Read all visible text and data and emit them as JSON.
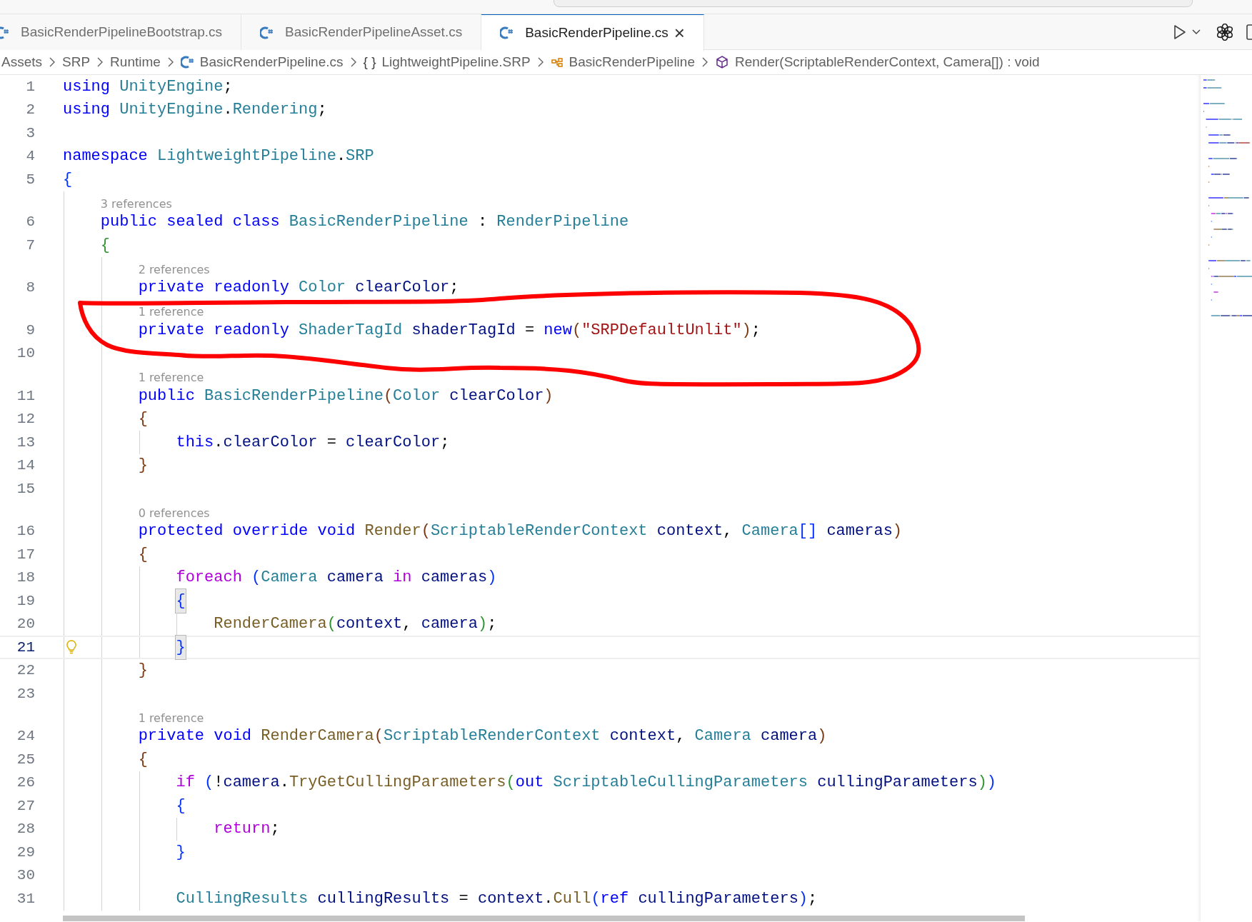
{
  "tabs": [
    {
      "label": "BasicRenderPipelineBootstrap.cs",
      "selected": false
    },
    {
      "label": "BasicRenderPipelineAsset.cs",
      "selected": false
    },
    {
      "label": "BasicRenderPipeline.cs",
      "selected": true,
      "close": "×"
    }
  ],
  "breadcrumb": [
    {
      "kind": "folder",
      "label": "Assets"
    },
    {
      "kind": "folder",
      "label": "SRP"
    },
    {
      "kind": "folder",
      "label": "Runtime"
    },
    {
      "kind": "file",
      "label": "BasicRenderPipeline.cs"
    },
    {
      "kind": "namespace",
      "glyph": "{ }",
      "label": "LightweightPipeline.SRP"
    },
    {
      "kind": "class",
      "label": "BasicRenderPipeline"
    },
    {
      "kind": "method",
      "label": "Render(ScriptableRenderContext, Camera[]) : void"
    }
  ],
  "lines": [
    {
      "number": "1",
      "tokens": [
        {
          "kind": "kw",
          "text": "using"
        },
        {
          "kind": "type",
          "text": " UnityEngine"
        },
        {
          "kind": "p",
          "text": ";"
        }
      ]
    },
    {
      "number": "2",
      "tokens": [
        {
          "kind": "kw",
          "text": "using"
        },
        {
          "kind": "type",
          "text": " UnityEngine"
        },
        {
          "kind": "p",
          "text": "."
        },
        {
          "kind": "type",
          "text": "Rendering"
        },
        {
          "kind": "p",
          "text": ";"
        }
      ]
    },
    {
      "number": "3"
    },
    {
      "number": "4",
      "tokens": [
        {
          "kind": "kw",
          "text": "namespace"
        },
        {
          "kind": "type",
          "text": " LightweightPipeline"
        },
        {
          "kind": "p",
          "text": "."
        },
        {
          "kind": "type",
          "text": "SRP"
        }
      ]
    },
    {
      "number": "5",
      "tokens": [
        {
          "kind": "b1",
          "text": "{"
        }
      ]
    },
    {
      "number": "6",
      "lens": "3 references",
      "tokens": [
        {
          "kind": "kw",
          "text": "    public sealed class"
        },
        {
          "kind": "type",
          "text": " BasicRenderPipeline"
        },
        {
          "kind": "p",
          "text": " :"
        },
        {
          "kind": "type",
          "text": " RenderPipeline"
        }
      ]
    },
    {
      "number": "7",
      "tokens": [
        {
          "kind": "b2",
          "text": "    {"
        }
      ]
    },
    {
      "number": "8",
      "lens": "2 references",
      "tokens": [
        {
          "kind": "kw",
          "text": "        private readonly"
        },
        {
          "kind": "type",
          "text": " Color"
        },
        {
          "kind": "var",
          "text": " clearColor"
        },
        {
          "kind": "p",
          "text": ";"
        }
      ]
    },
    {
      "number": "9",
      "lens": "1 reference",
      "tokens": [
        {
          "kind": "kw",
          "text": "        private readonly"
        },
        {
          "kind": "type",
          "text": " ShaderTagId"
        },
        {
          "kind": "var",
          "text": " shaderTagId"
        },
        {
          "kind": "p",
          "text": " ="
        },
        {
          "kind": "kw",
          "text": " new"
        },
        {
          "kind": "b3",
          "text": "("
        },
        {
          "kind": "str",
          "text": "\"SRPDefaultUnlit\""
        },
        {
          "kind": "b3",
          "text": ")"
        },
        {
          "kind": "p",
          "text": ";"
        }
      ]
    },
    {
      "number": "10"
    },
    {
      "number": "11",
      "lens": "1 reference",
      "tokens": [
        {
          "kind": "kw",
          "text": "        public"
        },
        {
          "kind": "type",
          "text": " BasicRenderPipeline"
        },
        {
          "kind": "b3",
          "text": "("
        },
        {
          "kind": "type",
          "text": "Color"
        },
        {
          "kind": "var",
          "text": " clearColor"
        },
        {
          "kind": "b3",
          "text": ")"
        }
      ]
    },
    {
      "number": "12",
      "tokens": [
        {
          "kind": "b3",
          "text": "        {"
        }
      ]
    },
    {
      "number": "13",
      "tokens": [
        {
          "kind": "kw",
          "text": "            this"
        },
        {
          "kind": "p",
          "text": "."
        },
        {
          "kind": "var",
          "text": "clearColor"
        },
        {
          "kind": "p",
          "text": " ="
        },
        {
          "kind": "var",
          "text": " clearColor"
        },
        {
          "kind": "p",
          "text": ";"
        }
      ]
    },
    {
      "number": "14",
      "tokens": [
        {
          "kind": "b3",
          "text": "        }"
        }
      ]
    },
    {
      "number": "15"
    },
    {
      "number": "16",
      "lens": "0 references",
      "tokens": [
        {
          "kind": "kw",
          "text": "        protected override void"
        },
        {
          "kind": "fn",
          "text": " Render"
        },
        {
          "kind": "b3",
          "text": "("
        },
        {
          "kind": "type",
          "text": "ScriptableRenderContext"
        },
        {
          "kind": "var",
          "text": " context"
        },
        {
          "kind": "p",
          "text": ","
        },
        {
          "kind": "type",
          "text": " Camera"
        },
        {
          "kind": "b1",
          "text": "[]"
        },
        {
          "kind": "var",
          "text": " cameras"
        },
        {
          "kind": "b3",
          "text": ")"
        }
      ]
    },
    {
      "number": "17",
      "tokens": [
        {
          "kind": "b3",
          "text": "        {"
        }
      ]
    },
    {
      "number": "18",
      "tokens": [
        {
          "kind": "ctl",
          "text": "            foreach"
        },
        {
          "kind": "b1",
          "text": " ("
        },
        {
          "kind": "type",
          "text": "Camera"
        },
        {
          "kind": "var",
          "text": " camera"
        },
        {
          "kind": "ctl",
          "text": " in"
        },
        {
          "kind": "var",
          "text": " cameras"
        },
        {
          "kind": "b1",
          "text": ")"
        }
      ]
    },
    {
      "number": "19",
      "tokens": [
        {
          "kind": "b1",
          "text": "            {",
          "matched": true
        }
      ]
    },
    {
      "number": "20",
      "tokens": [
        {
          "kind": "fn",
          "text": "                RenderCamera"
        },
        {
          "kind": "b2",
          "text": "("
        },
        {
          "kind": "var",
          "text": "context"
        },
        {
          "kind": "p",
          "text": ","
        },
        {
          "kind": "var",
          "text": " camera"
        },
        {
          "kind": "b2",
          "text": ")"
        },
        {
          "kind": "p",
          "text": ";"
        }
      ]
    },
    {
      "number": "21",
      "current": true,
      "tokens": [
        {
          "kind": "b1",
          "text": "            }",
          "matched": true
        }
      ]
    },
    {
      "number": "22",
      "tokens": [
        {
          "kind": "b3",
          "text": "        }"
        }
      ]
    },
    {
      "number": "23"
    },
    {
      "number": "24",
      "lens": "1 reference",
      "tokens": [
        {
          "kind": "kw",
          "text": "        private void"
        },
        {
          "kind": "fn",
          "text": " RenderCamera"
        },
        {
          "kind": "b3",
          "text": "("
        },
        {
          "kind": "type",
          "text": "ScriptableRenderContext"
        },
        {
          "kind": "var",
          "text": " context"
        },
        {
          "kind": "p",
          "text": ","
        },
        {
          "kind": "type",
          "text": " Camera"
        },
        {
          "kind": "var",
          "text": " camera"
        },
        {
          "kind": "b3",
          "text": ")"
        }
      ]
    },
    {
      "number": "25",
      "tokens": [
        {
          "kind": "b3",
          "text": "        {"
        }
      ]
    },
    {
      "number": "26",
      "tokens": [
        {
          "kind": "ctl",
          "text": "            if"
        },
        {
          "kind": "b1",
          "text": " ("
        },
        {
          "kind": "p",
          "text": "!"
        },
        {
          "kind": "var",
          "text": "camera"
        },
        {
          "kind": "p",
          "text": "."
        },
        {
          "kind": "fn",
          "text": "TryGetCullingParameters"
        },
        {
          "kind": "b2",
          "text": "("
        },
        {
          "kind": "kw",
          "text": "out"
        },
        {
          "kind": "type",
          "text": " ScriptableCullingParameters"
        },
        {
          "kind": "var",
          "text": " cullingParameters"
        },
        {
          "kind": "b2",
          "text": ")"
        },
        {
          "kind": "b1",
          "text": ")"
        }
      ]
    },
    {
      "number": "27",
      "tokens": [
        {
          "kind": "b1",
          "text": "            {"
        }
      ]
    },
    {
      "number": "28",
      "tokens": [
        {
          "kind": "ctl",
          "text": "                return"
        },
        {
          "kind": "p",
          "text": ";"
        }
      ]
    },
    {
      "number": "29",
      "tokens": [
        {
          "kind": "b1",
          "text": "            }"
        }
      ]
    },
    {
      "number": "30"
    },
    {
      "number": "31",
      "tokens": [
        {
          "kind": "type",
          "text": "            CullingResults"
        },
        {
          "kind": "var",
          "text": " cullingResults"
        },
        {
          "kind": "p",
          "text": " ="
        },
        {
          "kind": "var",
          "text": " context"
        },
        {
          "kind": "p",
          "text": "."
        },
        {
          "kind": "fn",
          "text": "Cull"
        },
        {
          "kind": "b1",
          "text": "("
        },
        {
          "kind": "kw",
          "text": "ref"
        },
        {
          "kind": "var",
          "text": " cullingParameters"
        },
        {
          "kind": "b1",
          "text": ")"
        },
        {
          "kind": "p",
          "text": ";"
        }
      ]
    }
  ]
}
